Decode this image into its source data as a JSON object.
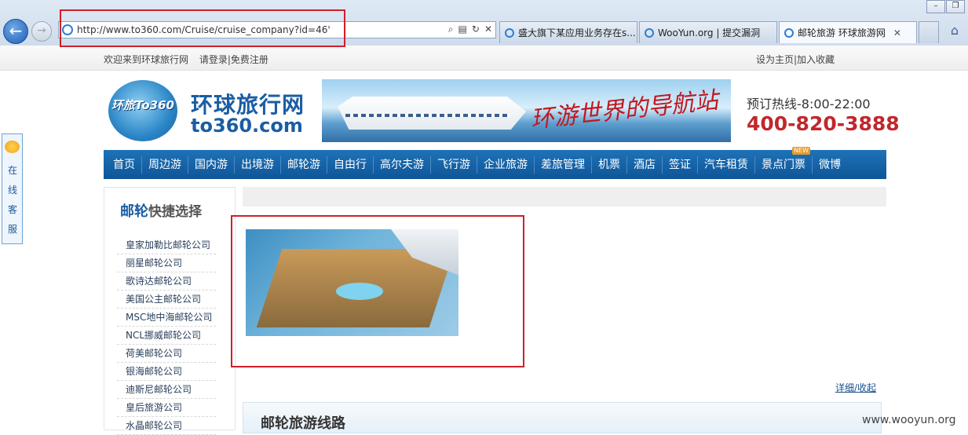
{
  "browser": {
    "url": "http://www.to360.com/Cruise/cruise_company?id=46'",
    "tabs": [
      {
        "label": "盛大旗下某应用业务存在s..."
      },
      {
        "label": "WooYun.org | 提交漏洞"
      },
      {
        "label": "邮轮旅游 环球旅游网",
        "active": true
      }
    ]
  },
  "topbar": {
    "welcome": "欢迎来到环球旅行网",
    "login": "请登录|免费注册",
    "right": "设为主页|加入收藏"
  },
  "logo": {
    "badge": "环旅To360",
    "cn": "环球旅行网",
    "en": "to360.com"
  },
  "banner": {
    "slogan": "环游世界的导航站"
  },
  "hotline": {
    "label": "预订热线-8:00-22:00",
    "number": "400-820-3888"
  },
  "nav": [
    "首页",
    "周边游",
    "国内游",
    "出境游",
    "邮轮游",
    "自由行",
    "高尔夫游",
    "飞行游",
    "企业旅游",
    "差旅管理",
    "机票",
    "酒店",
    "签证",
    "汽车租赁",
    "景点门票",
    "微博"
  ],
  "nav_new_badge": "NEW",
  "side_chat": {
    "label": "在线客服"
  },
  "sidebar": {
    "title_a": "邮轮",
    "title_b": "快捷选择",
    "companies": [
      "皇家加勒比邮轮公司",
      "丽星邮轮公司",
      "歌诗达邮轮公司",
      "美国公主邮轮公司",
      "MSC地中海邮轮公司",
      "NCL挪威邮轮公司",
      "荷美邮轮公司",
      "银海邮轮公司",
      "迪斯尼邮轮公司",
      "皇后旅游公司",
      "水晶邮轮公司"
    ]
  },
  "main": {
    "detail_link": "详细/收起",
    "section_title": "邮轮旅游线路"
  },
  "watermark": "www.wooyun.org",
  "colors": {
    "nav_bg": "#1565a8",
    "accent_red": "#c0282c",
    "highlight_box": "#d11f2a",
    "brand_blue": "#1a5da3"
  }
}
